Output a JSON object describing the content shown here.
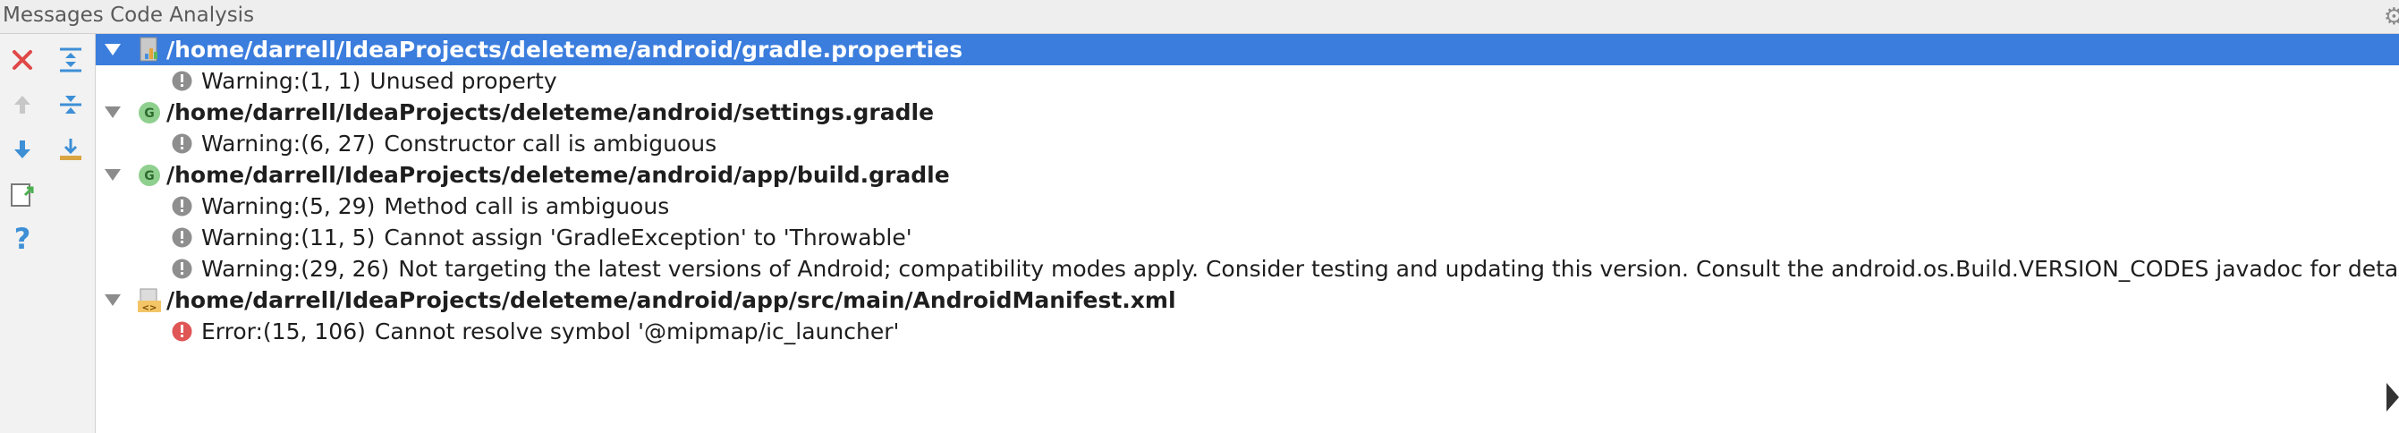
{
  "panel": {
    "title": "Messages Code Analysis"
  },
  "toolbar": {
    "buttons": [
      {
        "icon": "close-icon"
      },
      {
        "icon": "expand-all-icon"
      },
      {
        "icon": "prev-up-arrow-icon"
      },
      {
        "icon": "collapse-all-icon"
      },
      {
        "icon": "next-down-arrow-icon"
      },
      {
        "icon": "export-icon"
      },
      {
        "icon": "export-to-file-icon"
      },
      {
        "icon": "help-icon"
      }
    ]
  },
  "tree": {
    "groups": [
      {
        "path": "/home/darrell/IdeaProjects/deleteme/android/gradle.properties",
        "file_icon": "properties-file-icon",
        "selected": true,
        "messages": [
          {
            "severity": "warning",
            "location": "Warning:(1, 1)",
            "text": "Unused property"
          }
        ]
      },
      {
        "path": "/home/darrell/IdeaProjects/deleteme/android/settings.gradle",
        "file_icon": "gradle-file-icon",
        "selected": false,
        "messages": [
          {
            "severity": "warning",
            "location": "Warning:(6, 27)",
            "text": "Constructor call is ambiguous"
          }
        ]
      },
      {
        "path": "/home/darrell/IdeaProjects/deleteme/android/app/build.gradle",
        "file_icon": "gradle-file-icon",
        "selected": false,
        "messages": [
          {
            "severity": "warning",
            "location": "Warning:(5, 29)",
            "text": "Method call is ambiguous"
          },
          {
            "severity": "warning",
            "location": "Warning:(11, 5)",
            "text": "Cannot assign 'GradleException' to 'Throwable'"
          },
          {
            "severity": "warning",
            "location": "Warning:(29, 26)",
            "text": "Not targeting the latest versions of Android; compatibility modes apply. Consider testing and updating this version. Consult the android.os.Build.VERSION_CODES javadoc for details."
          }
        ]
      },
      {
        "path": "/home/darrell/IdeaProjects/deleteme/android/app/src/main/AndroidManifest.xml",
        "file_icon": "xml-file-icon",
        "selected": false,
        "messages": [
          {
            "severity": "error",
            "location": "Error:(15, 106)",
            "text": "Cannot resolve symbol '@mipmap/ic_launcher'"
          }
        ]
      }
    ]
  },
  "colors": {
    "selection": "#3b7ddd",
    "warning_icon": "#8e8e8e",
    "error_icon": "#e05555",
    "gradle_icon": "#8fd08f",
    "close_icon": "#e04848",
    "blue_icon": "#3d8fd6"
  }
}
